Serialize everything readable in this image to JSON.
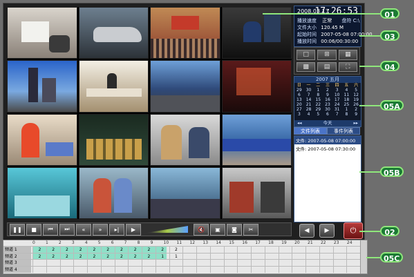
{
  "info": {
    "date": "2008.03.13",
    "time": "17:26:53",
    "speed_label": "播放速度",
    "speed_value": "正常",
    "channel_label": "盘符",
    "channel_value": "C:\\",
    "size_label": "文件大小",
    "size_value": "120.45 M",
    "start_label": "起始时间",
    "start_value": "2007-05-08 07:00:00",
    "play_label": "播放时间",
    "play_value": "00:06/00:30:00"
  },
  "calendar": {
    "header": "2007 五月",
    "weekdays": [
      "日",
      "一",
      "二",
      "三",
      "四",
      "五",
      "六"
    ],
    "weeks": [
      [
        "29",
        "30",
        "1",
        "2",
        "3",
        "4",
        "5"
      ],
      [
        "6",
        "7",
        "8",
        "9",
        "10",
        "11",
        "12"
      ],
      [
        "13",
        "14",
        "15",
        "16",
        "17",
        "18",
        "19"
      ],
      [
        "20",
        "21",
        "22",
        "23",
        "24",
        "25",
        "26"
      ],
      [
        "27",
        "28",
        "29",
        "30",
        "31",
        "1",
        "2"
      ],
      [
        "3",
        "4",
        "5",
        "6",
        "7",
        "8",
        "9"
      ]
    ],
    "today_label": "今天",
    "prev": "◂◂",
    "next": "▸▸"
  },
  "tabs": [
    "文件列表",
    "事件列表"
  ],
  "files": [
    "文件: 2007-05-08 07:00:00",
    "文件: 2007-05-08 07:30:00"
  ],
  "timeline": {
    "hours": [
      "0",
      "1",
      "2",
      "3",
      "4",
      "5",
      "6",
      "7",
      "8",
      "9",
      "10",
      "11",
      "12",
      "13",
      "14",
      "15",
      "16",
      "17",
      "18",
      "19",
      "20",
      "21",
      "22",
      "23",
      "24"
    ],
    "rows": [
      {
        "label": "频道 1",
        "marks": [
          "2",
          "2",
          "2",
          "2",
          "2",
          "2",
          "2",
          "2",
          "2",
          "2",
          "2"
        ]
      },
      {
        "label": "频道 2",
        "marks": [
          "2",
          "2",
          "2",
          "2",
          "2",
          "2",
          "2",
          "2",
          "2",
          "1",
          "1"
        ]
      },
      {
        "label": "频道 3",
        "marks": []
      },
      {
        "label": "频道 4",
        "marks": []
      }
    ]
  },
  "callouts": [
    "01",
    "03",
    "04",
    "05A",
    "05B",
    "02",
    "05C"
  ],
  "colors": {
    "accent": "#8fe77b",
    "panel": "#0d1830"
  }
}
